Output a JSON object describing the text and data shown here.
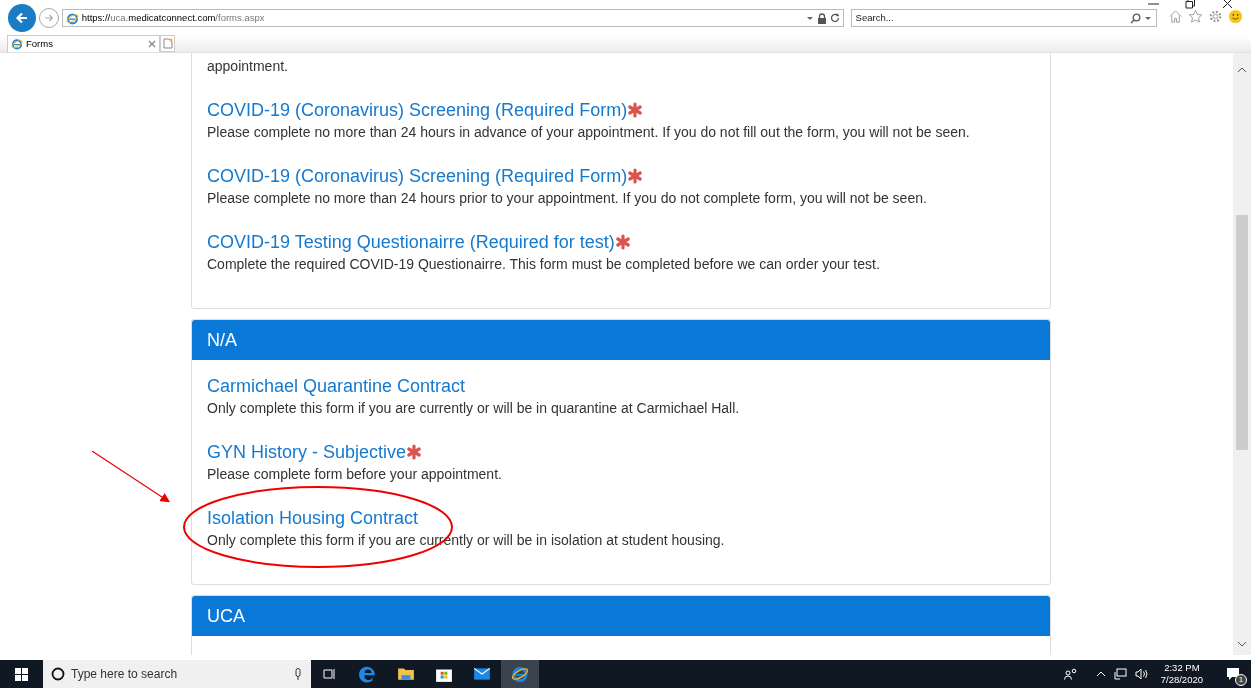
{
  "browser": {
    "url_segments": [
      {
        "text": "https://",
        "strong": true
      },
      {
        "text": "uca.",
        "strong": false
      },
      {
        "text": "medicatconnect.com",
        "strong": true
      },
      {
        "text": "/forms.aspx",
        "strong": false
      }
    ],
    "search": {
      "placeholder": "Search..."
    },
    "tabs": [
      {
        "label": "Forms",
        "selected": true
      }
    ]
  },
  "sections": [
    {
      "lead_text": "appointment.",
      "forms": [
        {
          "title": "COVID-19 (Coronavirus) Screening (Required Form)",
          "required": true,
          "description": "Please complete no more than 24 hours in advance of your appointment. If you do not fill out the form, you will not be seen."
        },
        {
          "title": "COVID-19 (Coronavirus) Screening (Required Form)",
          "required": true,
          "description": "Please complete no more than 24 hours prior to your appointment. If you do not complete form, you will not be seen."
        },
        {
          "title": "COVID-19 Testing Questionairre (Required for test)",
          "required": true,
          "description": "Complete the required COVID-19 Questionairre. This form must be completed before we can order your test."
        }
      ]
    },
    {
      "header": "N/A",
      "forms": [
        {
          "title": "Carmichael Quarantine Contract",
          "required": false,
          "description": "Only complete this form if you are currently or will be in quarantine at Carmichael Hall."
        },
        {
          "title": "GYN History - Subjective",
          "required": true,
          "description": "Please complete form before your appointment."
        },
        {
          "title": "Isolation Housing Contract",
          "required": false,
          "description": "Only complete this form if you are currently or will be in isolation at student housing."
        }
      ]
    },
    {
      "header": "UCA"
    }
  ],
  "taskbar": {
    "search_placeholder": "Type here to search",
    "time": "2:32 PM",
    "date": "7/28/2020",
    "notification_count": "1"
  }
}
